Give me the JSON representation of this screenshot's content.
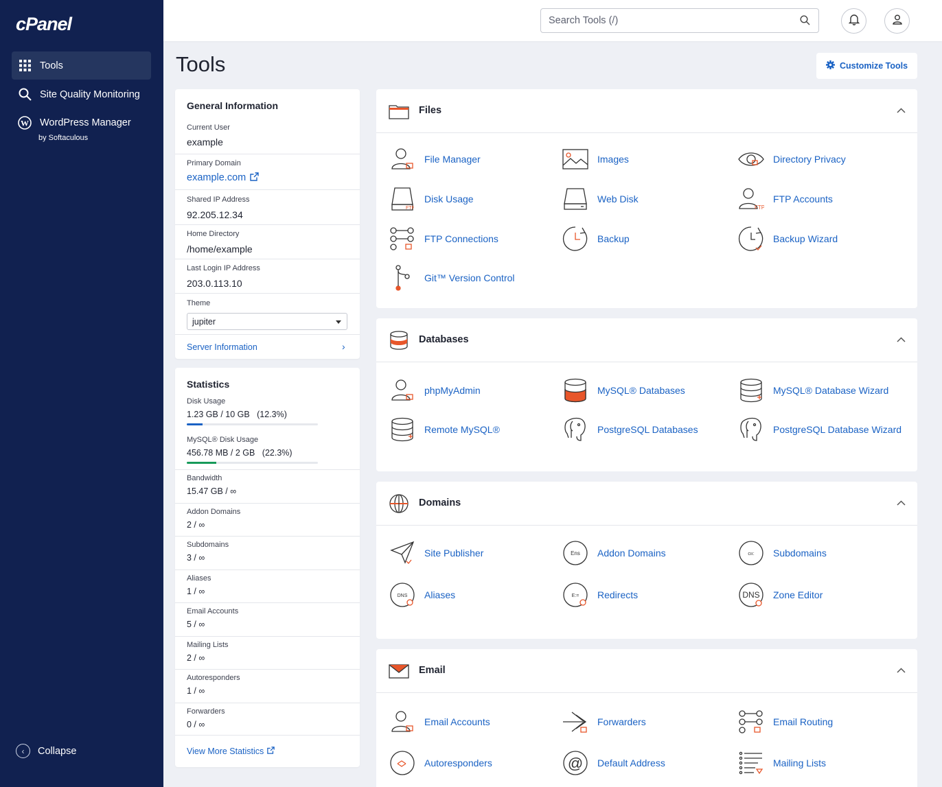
{
  "brand": {
    "logo_text": "cPanel"
  },
  "sidebar": {
    "items": [
      {
        "label": "Tools"
      },
      {
        "label": "Site Quality Monitoring"
      },
      {
        "label": "WordPress Manager",
        "sublabel": "by Softaculous"
      }
    ],
    "collapse_label": "Collapse"
  },
  "topbar": {
    "search_placeholder": "Search Tools (/)"
  },
  "page": {
    "title": "Tools",
    "customize_label": "Customize Tools"
  },
  "general_info": {
    "heading": "General Information",
    "current_user": {
      "label": "Current User",
      "value": "example"
    },
    "primary_domain": {
      "label": "Primary Domain",
      "value": "example.com"
    },
    "shared_ip": {
      "label": "Shared IP Address",
      "value": "92.205.12.34"
    },
    "home_dir": {
      "label": "Home Directory",
      "value": "/home/example"
    },
    "last_login": {
      "label": "Last Login IP Address",
      "value": "203.0.113.10"
    },
    "theme": {
      "label": "Theme",
      "value": "jupiter"
    },
    "server_info_label": "Server Information"
  },
  "statistics": {
    "heading": "Statistics",
    "disk_usage": {
      "label": "Disk Usage",
      "value": "1.23 GB / 10 GB   (12.3%)",
      "percent": 12.3,
      "color": "#1a62c4"
    },
    "mysql_disk": {
      "label": "MySQL® Disk Usage",
      "value": "456.78 MB / 2 GB   (22.3%)",
      "percent": 22.3,
      "color": "#179a5a"
    },
    "rows": [
      {
        "label": "Bandwidth",
        "value": "15.47 GB / ∞"
      },
      {
        "label": "Addon Domains",
        "value": "2 / ∞"
      },
      {
        "label": "Subdomains",
        "value": "3 / ∞"
      },
      {
        "label": "Aliases",
        "value": "1 / ∞"
      },
      {
        "label": "Email Accounts",
        "value": "5 / ∞"
      },
      {
        "label": "Mailing Lists",
        "value": "2 / ∞"
      },
      {
        "label": "Autoresponders",
        "value": "1 / ∞"
      },
      {
        "label": "Forwarders",
        "value": "0 / ∞"
      }
    ],
    "view_more_label": "View More Statistics"
  },
  "sections": {
    "files": {
      "title": "Files",
      "tools": [
        "File Manager",
        "Images",
        "Directory Privacy",
        "Disk Usage",
        "Web Disk",
        "FTP Accounts",
        "FTP Connections",
        "Backup",
        "Backup Wizard",
        "Git™ Version Control"
      ]
    },
    "databases": {
      "title": "Databases",
      "tools": [
        "phpMyAdmin",
        "MySQL® Databases",
        "MySQL® Database Wizard",
        "Remote MySQL®",
        "PostgreSQL Databases",
        "PostgreSQL Database Wizard"
      ]
    },
    "domains": {
      "title": "Domains",
      "tools": [
        "Site Publisher",
        "Addon Domains",
        "Subdomains",
        "Aliases",
        "Redirects",
        "Zone Editor"
      ]
    },
    "email": {
      "title": "Email",
      "tools": [
        "Email Accounts",
        "Forwarders",
        "Email Routing",
        "Autoresponders",
        "Default Address",
        "Mailing Lists"
      ]
    }
  },
  "colors": {
    "sidebar_bg": "#112150",
    "link": "#1a62c4",
    "accent": "#e8562a"
  }
}
